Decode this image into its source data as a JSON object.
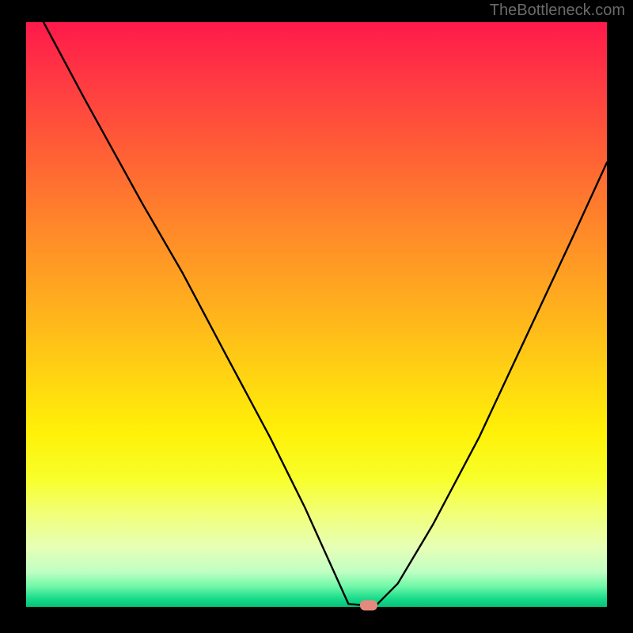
{
  "watermark": "TheBottleneck.com",
  "marker_color": "#e5897c",
  "gradient_stops": [
    {
      "offset": 0.0,
      "color": "#ff1a4b"
    },
    {
      "offset": 0.1,
      "color": "#ff3a43"
    },
    {
      "offset": 0.22,
      "color": "#ff5f36"
    },
    {
      "offset": 0.35,
      "color": "#ff882a"
    },
    {
      "offset": 0.48,
      "color": "#ffae1e"
    },
    {
      "offset": 0.6,
      "color": "#ffd313"
    },
    {
      "offset": 0.7,
      "color": "#fff108"
    },
    {
      "offset": 0.78,
      "color": "#f8ff2a"
    },
    {
      "offset": 0.84,
      "color": "#f2ff78"
    },
    {
      "offset": 0.9,
      "color": "#e6ffb8"
    },
    {
      "offset": 0.94,
      "color": "#c0ffc4"
    },
    {
      "offset": 0.965,
      "color": "#70f8a8"
    },
    {
      "offset": 0.985,
      "color": "#1cdd8c"
    },
    {
      "offset": 1.0,
      "color": "#05c279"
    }
  ],
  "chart_data": {
    "type": "line",
    "title": "",
    "xlabel": "",
    "ylabel": "",
    "xlim": [
      0,
      100
    ],
    "ylim": [
      0,
      100
    ],
    "series": [
      {
        "name": "bottleneck-curve",
        "x": [
          3,
          10,
          20,
          27,
          35,
          42,
          48,
          53,
          55.5,
          58,
          60.5,
          64,
          70,
          78,
          86,
          94,
          100
        ],
        "y": [
          100,
          87,
          69,
          57,
          42,
          29,
          17,
          6,
          0.5,
          0.3,
          0.5,
          4,
          14,
          29,
          46,
          63,
          76
        ]
      }
    ],
    "marker": {
      "x": 59,
      "y": 0.3
    }
  }
}
